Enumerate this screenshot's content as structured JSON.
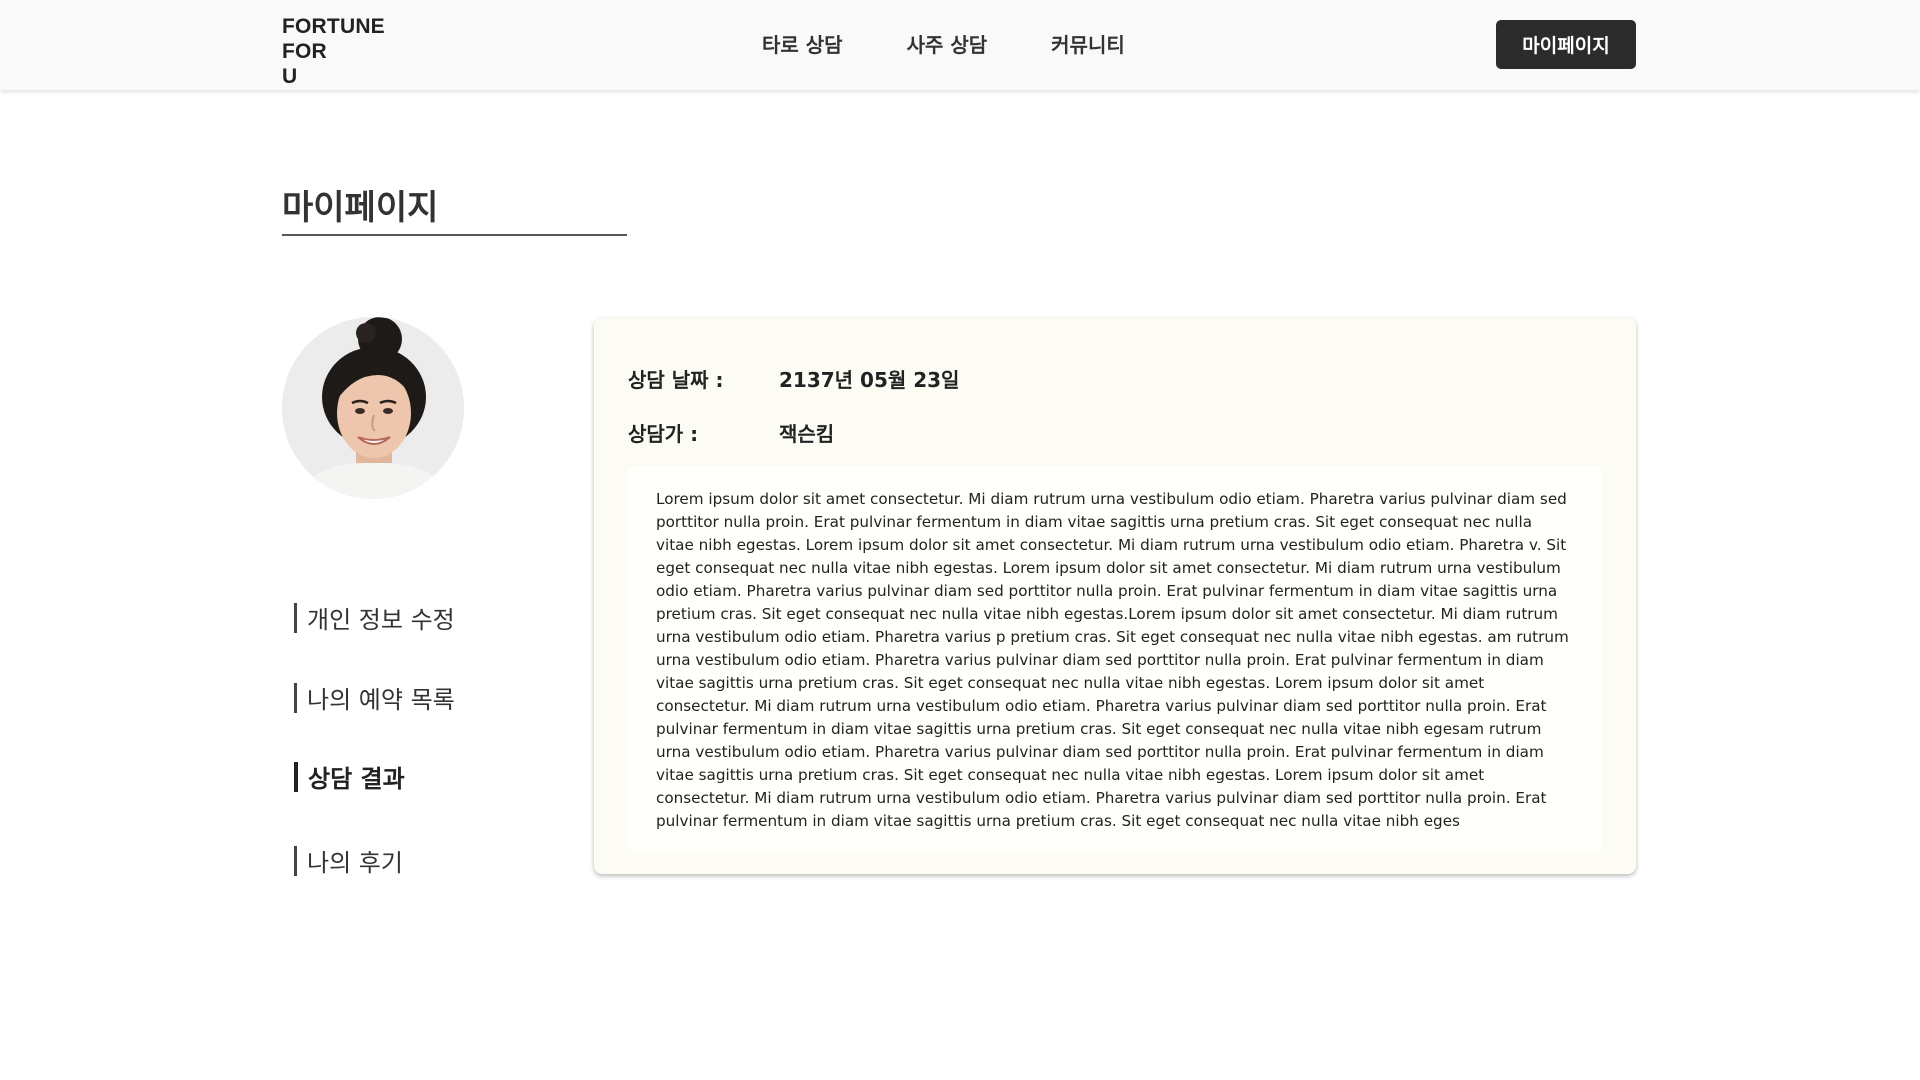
{
  "header": {
    "logo": "FORTUNE\nFOR\nU",
    "nav": [
      "타로 상담",
      "사주 상담",
      "커뮤니티"
    ],
    "mypage_button": "마이페이지"
  },
  "page": {
    "title": "마이페이지"
  },
  "side_menu": {
    "items": [
      "개인 정보 수정",
      "나의 예약 목록",
      "상담 결과",
      "나의 후기"
    ],
    "active": "상담 결과"
  },
  "result": {
    "date_label": "상담 날짜 :",
    "date_value": "2137년 05월 23일",
    "counselor_label": "상담가 :",
    "counselor_value": "잭슨킴",
    "content": "Lorem ipsum dolor sit amet consectetur. Mi diam rutrum urna vestibulum odio etiam. Pharetra varius pulvinar diam sed porttitor nulla proin. Erat pulvinar fermentum in diam vitae sagittis urna pretium cras. Sit eget consequat nec nulla vitae nibh egestas. Lorem ipsum dolor sit amet consectetur. Mi diam rutrum urna vestibulum odio etiam. Pharetra v. Sit eget consequat nec nulla vitae nibh egestas. Lorem ipsum dolor sit amet consectetur. Mi diam rutrum urna vestibulum odio etiam. Pharetra varius pulvinar diam sed porttitor nulla proin. Erat pulvinar fermentum in diam vitae sagittis urna pretium cras. Sit eget consequat nec nulla vitae nibh egestas.Lorem ipsum dolor sit amet consectetur. Mi diam rutrum urna vestibulum odio etiam. Pharetra varius p pretium cras. Sit eget consequat nec nulla vitae nibh egestas. am rutrum urna vestibulum odio etiam. Pharetra varius pulvinar diam sed porttitor nulla proin. Erat pulvinar fermentum in diam vitae sagittis urna pretium cras. Sit eget consequat nec nulla vitae nibh egestas. Lorem ipsum dolor sit amet consectetur. Mi diam rutrum urna vestibulum odio etiam. Pharetra varius pulvinar diam sed porttitor nulla proin. Erat pulvinar fermentum in diam vitae sagittis urna pretium cras. Sit eget consequat nec nulla vitae nibh egesam rutrum urna vestibulum odio etiam. Pharetra varius pulvinar diam sed porttitor nulla proin. Erat pulvinar fermentum in diam vitae sagittis urna pretium cras. Sit eget consequat nec nulla vitae nibh egestas. Lorem ipsum dolor sit amet consectetur. Mi diam rutrum urna vestibulum odio etiam. Pharetra varius pulvinar diam sed porttitor nulla proin. Erat pulvinar fermentum in diam vitae sagittis urna pretium cras. Sit eget consequat nec nulla vitae nibh eges"
  },
  "colors": {
    "header_bg": "#f9f9f9",
    "button_bg": "#2b2b2b",
    "card_bg": "#fcfbf4"
  }
}
